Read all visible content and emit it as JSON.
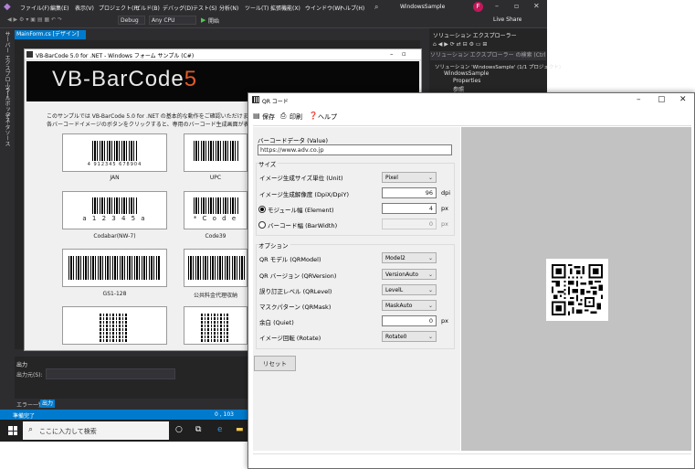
{
  "vs": {
    "menu": [
      "ファイル(F)",
      "編集(E)",
      "表示(V)",
      "プロジェクト(P)",
      "ビルド(B)",
      "デバッグ(D)",
      "テスト(S)",
      "分析(N)",
      "ツール(T)",
      "拡張機能(X)",
      "ウインドウ(W)",
      "ヘルプ(H)"
    ],
    "title": "WindowsSample",
    "avatar": "F",
    "config": "Debug",
    "platform": "Any CPU",
    "start": "開始",
    "live_share": "Live Share",
    "left_tabs": [
      "サーバー エクスプローラー",
      "ツールボックス",
      "データソース"
    ],
    "doc_tab": "MainForm.cs [デザイン]",
    "form_title": "VB-BarCode 5.0 for .NET - Windows フォーム サンプル (C#)",
    "banner_main": "VB-BarCode",
    "banner_num": "5",
    "intro1": "このサンプルでは VB-BarCode 5.0 for .NET の基本的な動作をご確認いただけます。",
    "intro2": "各バーコードイメージのボタンをクリックすると、専用のバーコード生成画面が表示さ",
    "barcodes": [
      {
        "label": "JAN",
        "digits": "4 912345 678904"
      },
      {
        "label": "UPC",
        "digits": ""
      },
      {
        "label": "Codabar(NW-7)",
        "digits": "a 1 2 3 4 5 a"
      },
      {
        "label": "Code39",
        "digits": "* C o d e"
      },
      {
        "label": "GS1-128",
        "digits": ""
      },
      {
        "label": "公共料金代理収納",
        "digits": ""
      }
    ],
    "output_title": "出力",
    "output_source": "出力元(S):",
    "error_tab": "エラー一覧",
    "output_tab": "出力",
    "status": "準備完了",
    "status_pos": "0 , 103",
    "search_placeholder": "ここに入力して検索",
    "se_title": "ソリューション エクスプローラー",
    "se_search": "ソリューション エクスプローラー の検索 (Ctrl+;)",
    "se_items": [
      "ソリューション 'WindowsSample' (1/1 プロジェクト)",
      "WindowsSample",
      "Properties",
      "参照"
    ]
  },
  "qr": {
    "title": "QR コード",
    "toolbar": {
      "save": "保存",
      "print": "印刷",
      "help": "ヘルプ"
    },
    "value_label": "バーコードデータ (Value)",
    "value": "https://www.adv.co.jp",
    "size_group": "サイズ",
    "unit_label": "イメージ生成サイズ単位 (Unit)",
    "unit_value": "Pixel",
    "dpi_label": "イメージ生成解像度 (DpiX/DpiY)",
    "dpi_value": "96",
    "dpi_unit": "dpi",
    "element_label": "モジュール幅 (Element)",
    "element_value": "4",
    "element_unit": "px",
    "barwidth_label": "バーコード幅 (BarWidth)",
    "barwidth_value": "0",
    "barwidth_unit": "px",
    "options_group": "オプション",
    "model_label": "QR モデル (QRModel)",
    "model_value": "Model2",
    "version_label": "QR バージョン (QRVersion)",
    "version_value": "VersionAuto",
    "level_label": "誤り訂正レベル (QRLevel)",
    "level_value": "LevelL",
    "mask_label": "マスクパターン (QRMask)",
    "mask_value": "MaskAuto",
    "quiet_label": "余白 (Quiet)",
    "quiet_value": "0",
    "quiet_unit": "px",
    "rotate_label": "イメージ回転 (Rotate)",
    "rotate_value": "Rotate0",
    "reset": "リセット"
  },
  "colors": {
    "vs_accent": "#007acc",
    "vs_bg": "#2d2d30",
    "logo_accent": "#e05a2a"
  }
}
